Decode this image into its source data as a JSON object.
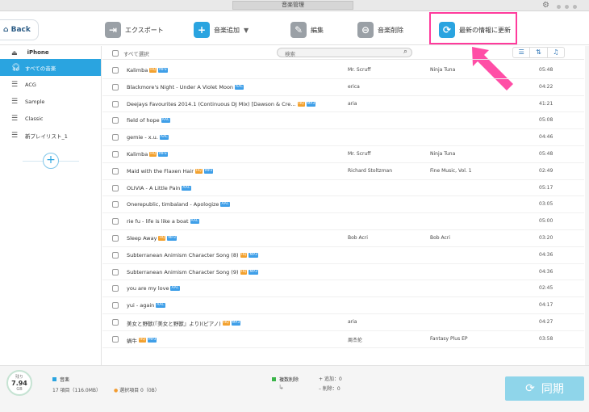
{
  "window": {
    "title": "音楽管理"
  },
  "toolbar": {
    "back_label": "Back",
    "export_label": "エクスポート",
    "add_music_label": "音楽追加",
    "edit_label": "編集",
    "delete_label": "音楽削除",
    "refresh_label": "最新の情報に更新",
    "highlight_color": "#ff3b9c",
    "accent_color": "#2aa4e0"
  },
  "sidebar": {
    "device": "iPhone",
    "items": [
      {
        "label": "すべての音楽",
        "icon": "headphones-icon",
        "active": true
      },
      {
        "label": "ACG",
        "icon": "playlist-icon",
        "active": false
      },
      {
        "label": "Sample",
        "icon": "playlist-icon",
        "active": false
      },
      {
        "label": "Classic",
        "icon": "playlist-icon",
        "active": false
      },
      {
        "label": "新プレイリスト_1",
        "icon": "playlist-icon",
        "active": false
      }
    ],
    "add_label": "+"
  },
  "list": {
    "select_all_label": "すべて選択",
    "search_placeholder": "検索",
    "rows": [
      {
        "title": "Kalimba",
        "badges": [
          "HQ",
          "MP3"
        ],
        "artist": "Mr. Scruff",
        "album": "Ninja Tuna",
        "duration": "05:48"
      },
      {
        "title": "Blackmore's Night - Under A Violet Moon",
        "badges": [
          "AAC"
        ],
        "artist": "erica",
        "album": "",
        "duration": "04:22"
      },
      {
        "title": "Deejays Favourites 2014.1 (Continuous DJ Mix) [Dawson & Cre…",
        "badges": [
          "HQ",
          "MP3"
        ],
        "artist": "aria",
        "album": "",
        "duration": "41:21"
      },
      {
        "title": "field of hope",
        "badges": [
          "AAC"
        ],
        "artist": "",
        "album": "",
        "duration": "05:08"
      },
      {
        "title": "gemie - x.u.",
        "badges": [
          "AAC"
        ],
        "artist": "",
        "album": "",
        "duration": "04:46"
      },
      {
        "title": "Kalimba",
        "badges": [
          "HQ",
          "MP3"
        ],
        "artist": "Mr. Scruff",
        "album": "Ninja Tuna",
        "duration": "05:48"
      },
      {
        "title": "Maid with the Flaxen Hair",
        "badges": [
          "HQ",
          "MP3"
        ],
        "artist": "Richard Stoltzman",
        "album": "Fine Music, Vol. 1",
        "duration": "02:49"
      },
      {
        "title": "OLIVIA - A Little Pain",
        "badges": [
          "AAC"
        ],
        "artist": "",
        "album": "",
        "duration": "05:17"
      },
      {
        "title": "Onerepublic, timbaland - Apologize",
        "badges": [
          "AAC"
        ],
        "artist": "",
        "album": "",
        "duration": "03:05"
      },
      {
        "title": "rie fu - life is like a boat",
        "badges": [
          "AAC"
        ],
        "artist": "",
        "album": "",
        "duration": "05:00"
      },
      {
        "title": "Sleep Away",
        "badges": [
          "HQ",
          "MP3"
        ],
        "artist": "Bob Acri",
        "album": "Bob Acri",
        "duration": "03:20"
      },
      {
        "title": "Subterranean Animism Character Song (8)",
        "badges": [
          "HQ",
          "MP3"
        ],
        "artist": "",
        "album": "",
        "duration": "04:36"
      },
      {
        "title": "Subterranean Animism Character Song (9)",
        "badges": [
          "HQ",
          "MP3"
        ],
        "artist": "",
        "album": "",
        "duration": "04:36"
      },
      {
        "title": "you are my love",
        "badges": [
          "AAC"
        ],
        "artist": "",
        "album": "",
        "duration": "02:45"
      },
      {
        "title": "yui - again",
        "badges": [
          "AAC"
        ],
        "artist": "",
        "album": "",
        "duration": "04:17"
      },
      {
        "title": "美女と野獣(『美女と野獣』より)(ピアノ)",
        "badges": [
          "HQ",
          "MP3"
        ],
        "artist": "aria",
        "album": "",
        "duration": "04:27"
      },
      {
        "title": "蝸牛",
        "badges": [
          "HQ",
          "MP3"
        ],
        "artist": "周杰伦",
        "album": "Fantasy Plus EP",
        "duration": "03:58"
      }
    ]
  },
  "footer": {
    "storage_label": "残り",
    "storage_value": "7.94",
    "storage_unit": "GB",
    "music_label": "音楽",
    "items_text": "17 項目（116.0MB）",
    "selected_text": "選択項目 0（0B）",
    "perm_delete_label": "複数削除",
    "add_count_text": "追加：0",
    "delete_count_text": "削除：0",
    "sync_label": "同期",
    "music_color": "#2aa4e0",
    "delete_color": "#3bb54a"
  }
}
